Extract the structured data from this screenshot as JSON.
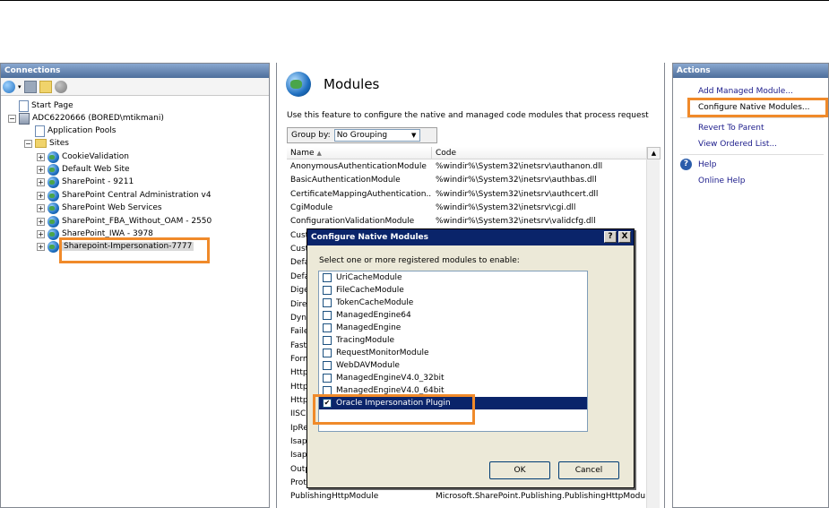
{
  "connections": {
    "title": "Connections",
    "tree": [
      {
        "label": "Start Page",
        "indent": 0
      },
      {
        "label": "ADC6220666 (BORED\\mtikmani)",
        "indent": 0
      },
      {
        "label": "Application Pools",
        "indent": 1
      },
      {
        "label": "Sites",
        "indent": 1
      },
      {
        "label": "CookieValidation",
        "indent": 2
      },
      {
        "label": "Default Web Site",
        "indent": 2
      },
      {
        "label": "SharePoint - 9211",
        "indent": 2
      },
      {
        "label": "SharePoint Central Administration v4",
        "indent": 2
      },
      {
        "label": "SharePoint Web Services",
        "indent": 2
      },
      {
        "label": "SharePoint_FBA_Without_OAM - 2550",
        "indent": 2
      },
      {
        "label": "SharePoint_IWA - 3978",
        "indent": 2
      },
      {
        "label": "Sharepoint-Impersonation-7777",
        "indent": 2
      }
    ]
  },
  "modules": {
    "title": "Modules",
    "description": "Use this feature to configure the native and managed code modules that process request",
    "group_by_label": "Group by:",
    "group_by_value": "No Grouping",
    "columns": [
      "Name",
      "Code"
    ],
    "rows": [
      {
        "name": "AnonymousAuthenticationModule",
        "code": "%windir%\\System32\\inetsrv\\authanon.dll"
      },
      {
        "name": "BasicAuthenticationModule",
        "code": "%windir%\\System32\\inetsrv\\authbas.dll"
      },
      {
        "name": "CertificateMappingAuthentication...",
        "code": "%windir%\\System32\\inetsrv\\authcert.dll"
      },
      {
        "name": "CgiModule",
        "code": "%windir%\\System32\\inetsrv\\cgi.dll"
      },
      {
        "name": "ConfigurationValidationModule",
        "code": "%windir%\\System32\\inetsrv\\validcfg.dll"
      },
      {
        "name": "Cust",
        "code": ""
      },
      {
        "name": "Cust",
        "code": ""
      },
      {
        "name": "Defa",
        "code": ""
      },
      {
        "name": "Defa",
        "code": ""
      },
      {
        "name": "Dige",
        "code": ""
      },
      {
        "name": "Direc",
        "code": ""
      },
      {
        "name": "Dyna",
        "code": ""
      },
      {
        "name": "Faile",
        "code": ""
      },
      {
        "name": "Fast",
        "code": ""
      },
      {
        "name": "Form",
        "code": ""
      },
      {
        "name": "Http",
        "code": ""
      },
      {
        "name": "Http",
        "code": ""
      },
      {
        "name": "Http",
        "code": ""
      },
      {
        "name": "IISC",
        "code": ""
      },
      {
        "name": "IpRe",
        "code": ""
      },
      {
        "name": "Isap",
        "code": ""
      },
      {
        "name": "Isap",
        "code": ""
      },
      {
        "name": "Outp",
        "code": ""
      },
      {
        "name": "Prot",
        "code": ""
      },
      {
        "name": "PublishingHttpModule",
        "code": "Microsoft.SharePoint.Publishing.PublishingHttpModu"
      }
    ]
  },
  "dialog": {
    "title": "Configure Native Modules",
    "help_btn": "?",
    "close_btn": "X",
    "prompt": "Select one or more registered modules to enable:",
    "items": [
      {
        "label": "UriCacheModule",
        "checked": false
      },
      {
        "label": "FileCacheModule",
        "checked": false
      },
      {
        "label": "TokenCacheModule",
        "checked": false
      },
      {
        "label": "ManagedEngine64",
        "checked": false
      },
      {
        "label": "ManagedEngine",
        "checked": false
      },
      {
        "label": "TracingModule",
        "checked": false
      },
      {
        "label": "RequestMonitorModule",
        "checked": false
      },
      {
        "label": "WebDAVModule",
        "checked": false
      },
      {
        "label": "ManagedEngineV4.0_32bit",
        "checked": false
      },
      {
        "label": "ManagedEngineV4.0_64bit",
        "checked": false
      },
      {
        "label": "Oracle Impersonation Plugin",
        "checked": true
      }
    ],
    "ok": "OK",
    "cancel": "Cancel"
  },
  "actions": {
    "title": "Actions",
    "add_managed": "Add Managed Module...",
    "configure_native": "Configure Native Modules...",
    "revert": "Revert To Parent",
    "view_ordered": "View Ordered List...",
    "help": "Help",
    "online_help": "Online Help"
  },
  "colors": {
    "highlight": "#f08a2a",
    "selection": "#0a246a"
  }
}
